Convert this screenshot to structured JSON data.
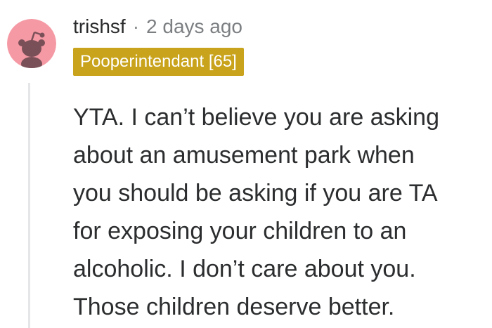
{
  "comment": {
    "avatar": {
      "icon": "snoo-avatar-icon",
      "background_color": "#f59aa5",
      "figure_color": "#7a5058"
    },
    "username": "trishsf",
    "separator": "·",
    "timestamp": "2 days ago",
    "flair": {
      "text": "Pooperintendant [65]",
      "color": "#c8a31b"
    },
    "body_lines": [
      "YTA. I can’t believe you are asking",
      "about an amusement park when",
      "you should be asking if you are TA",
      "for exposing your children to an",
      "alcoholic. I don’t care about you.",
      "Those children deserve better."
    ]
  }
}
